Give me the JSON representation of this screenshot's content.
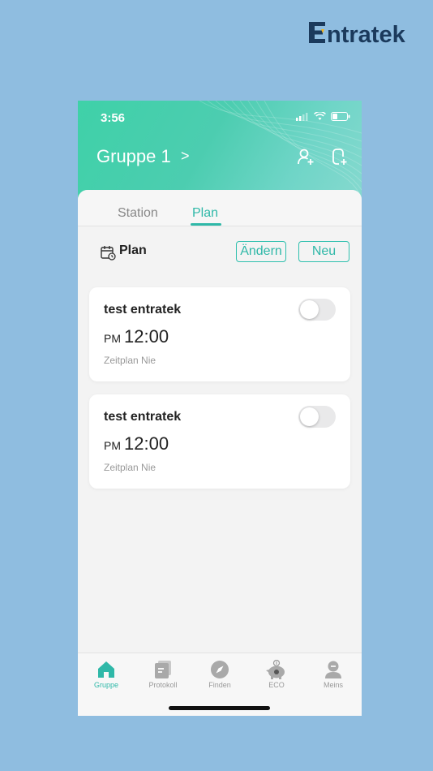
{
  "brand": {
    "name": "Entratek",
    "color": "#1b3a5c",
    "accent": "#f2b41c"
  },
  "status_bar": {
    "time": "3:56"
  },
  "header": {
    "group_title": "Gruppe 1",
    "chevron": ">",
    "icons": [
      "add-user-icon",
      "add-device-icon"
    ]
  },
  "tabs": [
    {
      "label": "Station",
      "active": false
    },
    {
      "label": "Plan",
      "active": true
    }
  ],
  "plan_section": {
    "label": "Plan",
    "icon": "calendar-clock-icon",
    "edit_label": "Ändern",
    "new_label": "Neu"
  },
  "schedules": [
    {
      "name": "test entratek",
      "ampm": "PM",
      "time": "12:00",
      "repeat": "Zeitplan Nie",
      "enabled": false
    },
    {
      "name": "test entratek",
      "ampm": "PM",
      "time": "12:00",
      "repeat": "Zeitplan Nie",
      "enabled": false
    }
  ],
  "tabbar": [
    {
      "label": "Gruppe",
      "icon": "home-icon",
      "active": true
    },
    {
      "label": "Protokoll",
      "icon": "log-icon",
      "active": false
    },
    {
      "label": "Finden",
      "icon": "compass-icon",
      "active": false
    },
    {
      "label": "ECO",
      "icon": "piggy-bank-icon",
      "active": false
    },
    {
      "label": "Meins",
      "icon": "profile-icon",
      "active": false
    }
  ],
  "colors": {
    "accent": "#2fb8a8",
    "background": "#8fbde0"
  }
}
